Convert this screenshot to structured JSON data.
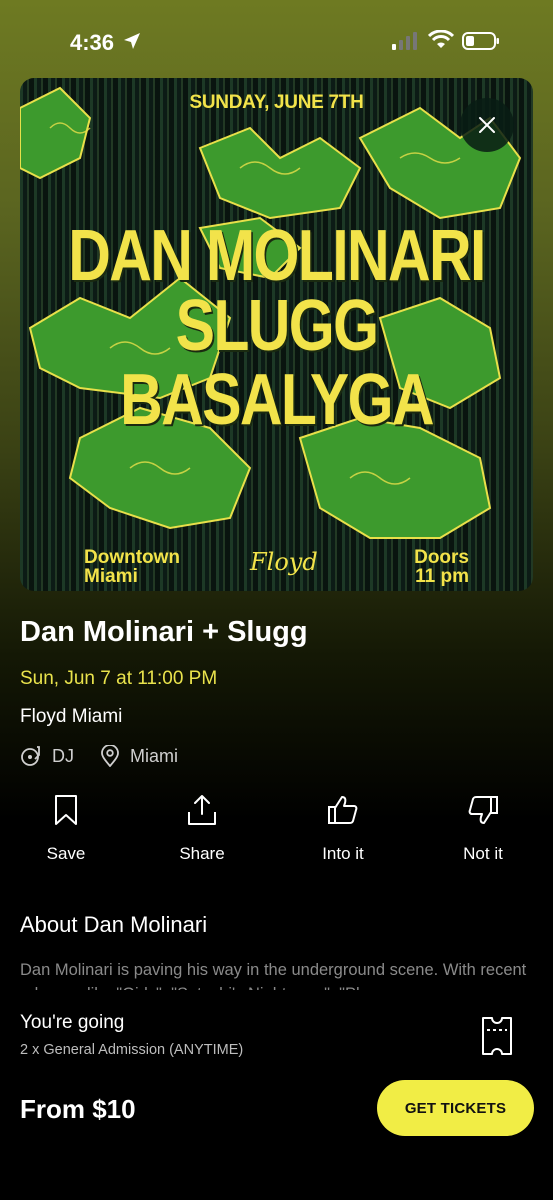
{
  "status_bar": {
    "time": "4:36"
  },
  "poster": {
    "date": "SUNDAY, JUNE 7TH",
    "line1": "DAN MOLINARI",
    "line2": "SLUGG",
    "line3": "BASALYGA",
    "location_line1": "Downtown",
    "location_line2": "Miami",
    "brand": "Floyd",
    "doors_line1": "Doors",
    "doors_line2": "11 pm"
  },
  "event": {
    "title": "Dan Molinari + Slugg",
    "datetime": "Sun, Jun 7 at 11:00 PM",
    "venue": "Floyd Miami",
    "tags": [
      {
        "label": "DJ",
        "icon": "dj-icon"
      },
      {
        "label": "Miami",
        "icon": "location-pin-icon"
      }
    ]
  },
  "actions": [
    {
      "label": "Save",
      "icon": "bookmark-icon"
    },
    {
      "label": "Share",
      "icon": "share-icon"
    },
    {
      "label": "Into it",
      "icon": "thumbs-up-icon"
    },
    {
      "label": "Not it",
      "icon": "thumbs-down-icon"
    }
  ],
  "about": {
    "heading": "About Dan Molinari",
    "body": "Dan Molinari is paving his way in the underground scene. With recent releases like \"Girls\", \"Satoshi's Nightmare\", \"Pl"
  },
  "ticket": {
    "status": "You're going",
    "details": "2 x General Admission (ANYTIME)",
    "price": "From $10",
    "button": "GET TICKETS"
  },
  "colors": {
    "accent": "#e9e34c",
    "button": "#f1ed45",
    "poster_text": "#f2e34a"
  }
}
